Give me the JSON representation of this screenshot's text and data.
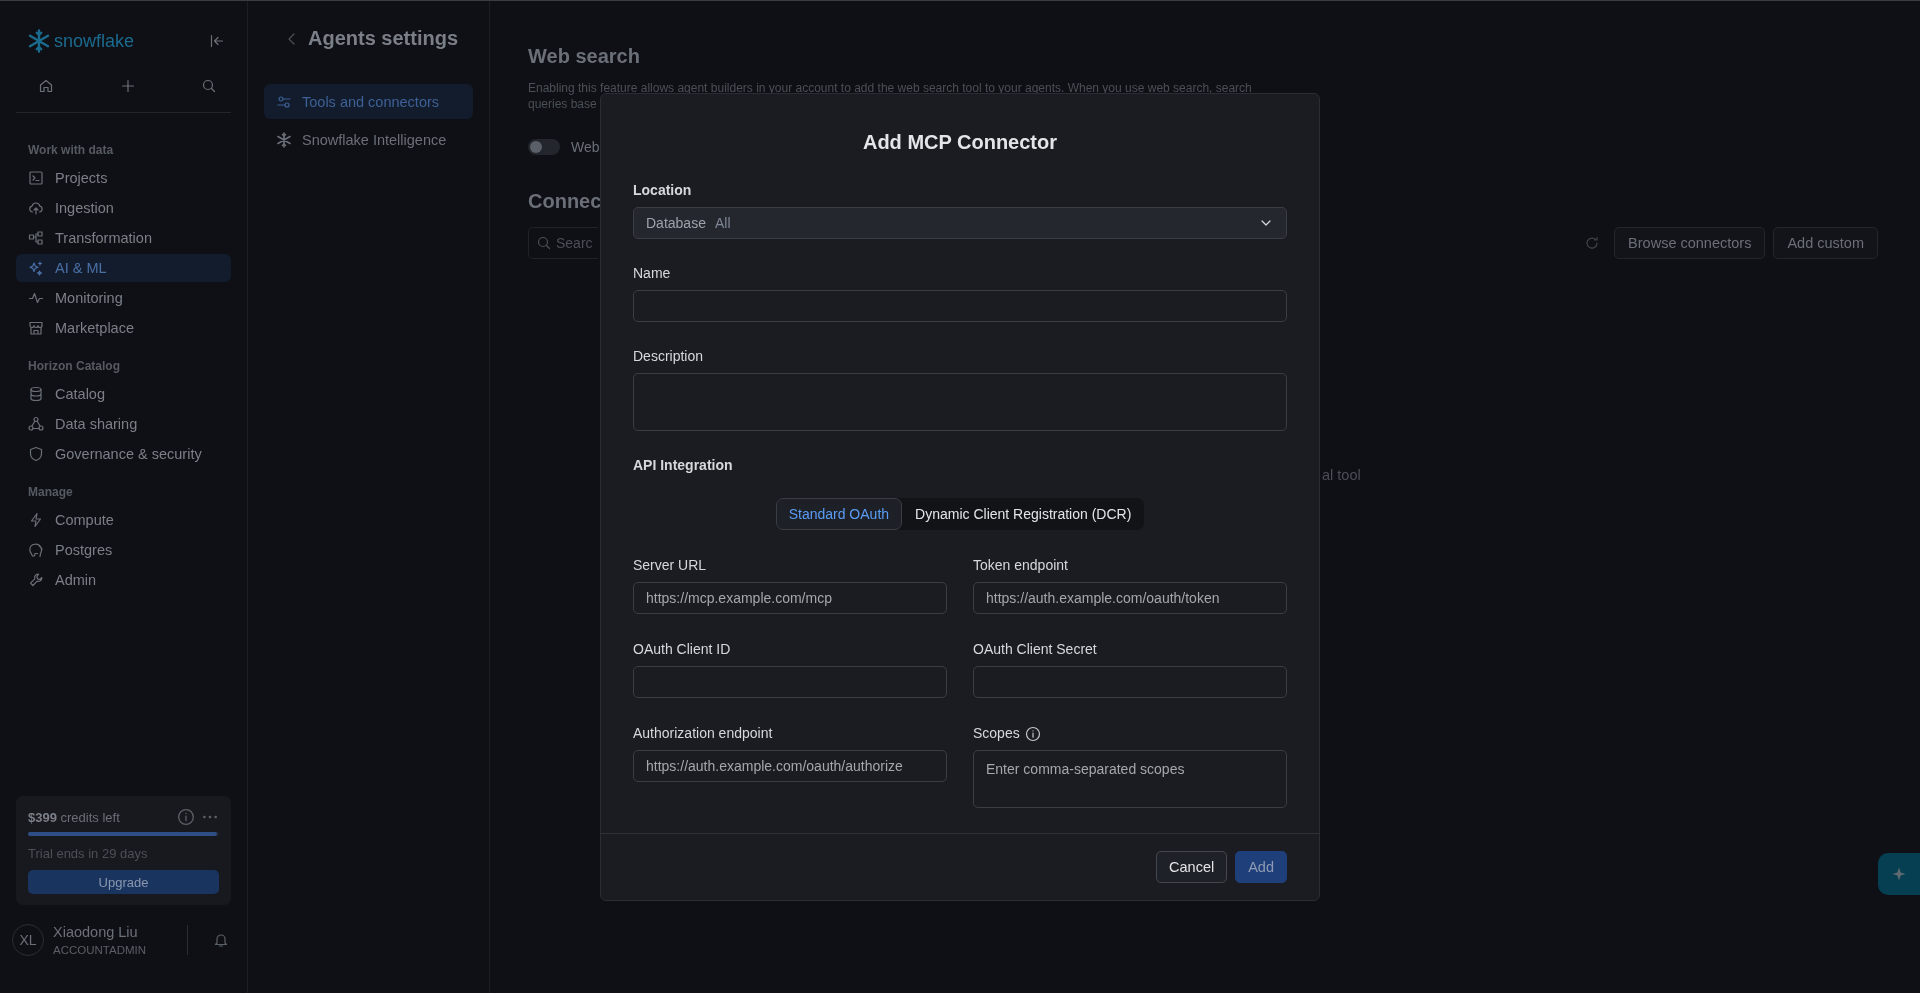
{
  "sidebar": {
    "logo_text": "snowflake",
    "sections": [
      {
        "heading": "Work with data",
        "items": [
          {
            "label": "Projects",
            "selected": false
          },
          {
            "label": "Ingestion",
            "selected": false
          },
          {
            "label": "Transformation",
            "selected": false
          },
          {
            "label": "AI & ML",
            "selected": true
          },
          {
            "label": "Monitoring",
            "selected": false
          },
          {
            "label": "Marketplace",
            "selected": false
          }
        ]
      },
      {
        "heading": "Horizon Catalog",
        "items": [
          {
            "label": "Catalog",
            "selected": false
          },
          {
            "label": "Data sharing",
            "selected": false
          },
          {
            "label": "Governance & security",
            "selected": false
          }
        ]
      },
      {
        "heading": "Manage",
        "items": [
          {
            "label": "Compute",
            "selected": false
          },
          {
            "label": "Postgres",
            "selected": false
          },
          {
            "label": "Admin",
            "selected": false
          }
        ]
      }
    ],
    "credits": {
      "text": "**$399** credits left",
      "level": 0.99,
      "trial": "Trial ends in 29 days",
      "button": "Upgrade"
    },
    "user": {
      "initials": "XL",
      "name": "Xiaodong Liu",
      "role": "ACCOUNTADMIN"
    }
  },
  "settings": {
    "title": "Agents settings",
    "items": [
      {
        "label": "Tools and connectors",
        "selected": true
      },
      {
        "label": "Snowflake Intelligence",
        "selected": false
      }
    ]
  },
  "web_search": {
    "title": "Web search",
    "description_lines": [
      "Enabling this feature allows agent builders in your account to add the web search tool to your agents. When you use web search, search",
      "queries base"
    ],
    "toggle": {
      "on": false,
      "label": "Web"
    }
  },
  "connectors": {
    "title": "Connec",
    "search_placeholder": "Searc",
    "buttons": [
      "Browse connectors",
      "Add custom"
    ],
    "empty_text": "al tool"
  },
  "dialog": {
    "title": "Add MCP Connector",
    "location": {
      "label": "Location",
      "prefix": "Database",
      "value": "All"
    },
    "name": {
      "label": "Name"
    },
    "description": {
      "label": "Description"
    },
    "api_title": "API Integration",
    "tabs": [
      {
        "label": "Standard OAuth",
        "selected": true
      },
      {
        "label": "Dynamic Client Registration (DCR)",
        "selected": false
      }
    ],
    "fields": [
      {
        "label": "Server URL",
        "placeholder": "https://mcp.example.com/mcp",
        "kind": "input"
      },
      {
        "label": "Token endpoint",
        "placeholder": "https://auth.example.com/oauth/token",
        "kind": "input"
      },
      {
        "label": "OAuth Client ID",
        "kind": "input"
      },
      {
        "label": "OAuth Client Secret",
        "kind": "input"
      },
      {
        "label": "Authorization endpoint",
        "placeholder": "https://auth.example.com/oauth/authorize",
        "kind": "input"
      },
      {
        "label": "Scopes",
        "placeholder": "Enter comma-separated scopes",
        "kind": "textarea_info"
      }
    ],
    "buttons": [
      {
        "label": "Cancel",
        "kind": "secondary",
        "disabled": false
      },
      {
        "label": "Add",
        "kind": "primary",
        "disabled": true
      }
    ]
  }
}
